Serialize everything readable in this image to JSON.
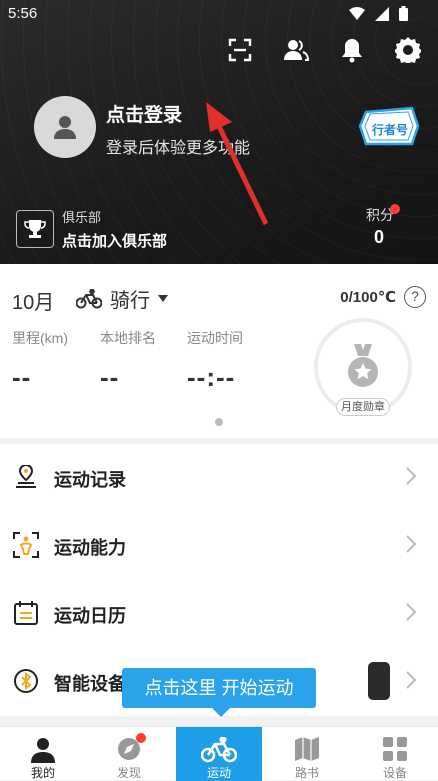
{
  "status_bar": {
    "time": "5:56"
  },
  "user": {
    "login_title": "点击登录",
    "login_subtitle": "登录后体验更多功能",
    "badge_label": "行者号"
  },
  "club": {
    "label": "俱乐部",
    "action": "点击加入俱乐部"
  },
  "points": {
    "label": "积分",
    "value": "0"
  },
  "stats": {
    "month": "10月",
    "sport": "骑行",
    "temperature": "0/100℃",
    "help": "?",
    "metrics": [
      {
        "label": "里程(km)",
        "value": "--"
      },
      {
        "label": "本地排名",
        "value": "--"
      },
      {
        "label": "运动时间",
        "value": "--:--"
      }
    ],
    "medal_label": "月度勋章"
  },
  "menu": [
    {
      "label": "运动记录",
      "icon": "location-pin-icon"
    },
    {
      "label": "运动能力",
      "icon": "body-scan-icon"
    },
    {
      "label": "运动日历",
      "icon": "calendar-icon"
    },
    {
      "label": "智能设备",
      "icon": "bluetooth-icon"
    }
  ],
  "tooltip": "点击这里 开始运动",
  "tabs": [
    {
      "label": "我的",
      "icon": "person-icon"
    },
    {
      "label": "发现",
      "icon": "compass-icon"
    },
    {
      "label": "运动",
      "icon": "bicycle-icon"
    },
    {
      "label": "路书",
      "icon": "map-icon"
    },
    {
      "label": "设备",
      "icon": "grid-icon"
    }
  ],
  "colors": {
    "accent": "#1e9ee8",
    "tooltip": "#2aa3ea",
    "notification": "#ff3b30",
    "arrow": "#e0302c"
  }
}
